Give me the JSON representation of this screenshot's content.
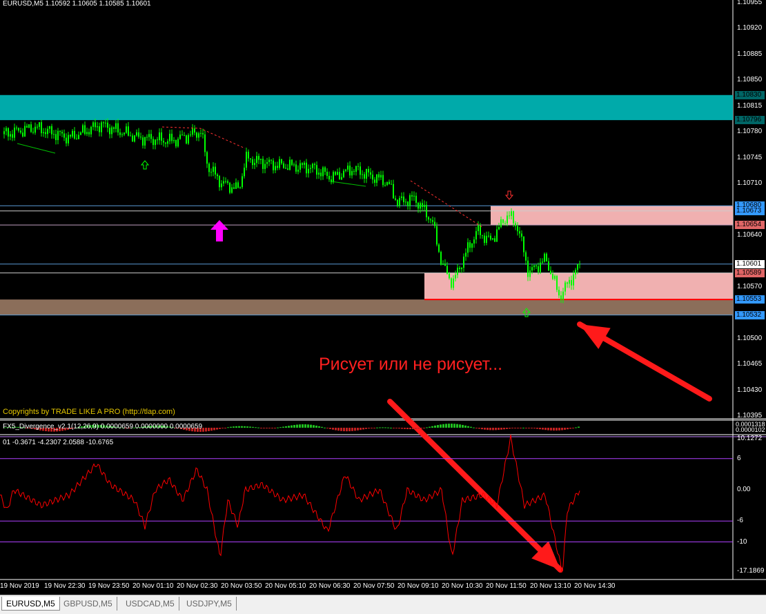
{
  "header": {
    "symbol_info": "EURUSD,M5  1.10592 1.10605 1.10585 1.10601"
  },
  "copyright": "Copyrights by TRADE LIKE A PRO (http://tlap.com)",
  "annotation": "Рисует или не рисует...",
  "macd_panel": {
    "label": "FX5_Divergence_v2.1(12,26,9) 0.0000659 0.0000000 0.0000659",
    "scale_top": "0.0001318",
    "scale_bottom": "0.0000102"
  },
  "osc_panel": {
    "label": "01 -0.3671 -4.2307 2.0588 -10.6765",
    "ticks": [
      "10.1272",
      "6",
      "0.00",
      "-6",
      "-10",
      "-17.1869"
    ]
  },
  "price_axis": {
    "ticks": [
      "1.10955",
      "1.10920",
      "1.10885",
      "1.10850",
      "1.10815",
      "1.10780",
      "1.10745",
      "1.10710",
      "1.10640",
      "1.10570",
      "1.10500",
      "1.10465",
      "1.10430",
      "1.10395"
    ]
  },
  "price_labels": [
    {
      "text": "1.10830",
      "price": 1.1083,
      "bg": "#006666",
      "fg": "#000"
    },
    {
      "text": "1.10796",
      "price": 1.10796,
      "bg": "#006666",
      "fg": "#000"
    },
    {
      "text": "1.10680",
      "price": 1.1068,
      "bg": "#3399ff",
      "fg": "#000"
    },
    {
      "text": "1.10673",
      "price": 1.10673,
      "bg": "#3399ff",
      "fg": "#000"
    },
    {
      "text": "1.10654",
      "price": 1.10654,
      "bg": "#e06666",
      "fg": "#000"
    },
    {
      "text": "1.10601",
      "price": 1.10601,
      "bg": "#ffffff",
      "fg": "#000"
    },
    {
      "text": "1.10589",
      "price": 1.10589,
      "bg": "#e06666",
      "fg": "#000"
    },
    {
      "text": "1.10553",
      "price": 1.10553,
      "bg": "#3399ff",
      "fg": "#000"
    },
    {
      "text": "1.10532",
      "price": 1.10532,
      "bg": "#3399ff",
      "fg": "#000"
    }
  ],
  "time_axis": [
    "19 Nov 2019",
    "19 Nov 22:30",
    "19 Nov 23:50",
    "20 Nov 01:10",
    "20 Nov 02:30",
    "20 Nov 03:50",
    "20 Nov 05:10",
    "20 Nov 06:30",
    "20 Nov 07:50",
    "20 Nov 09:10",
    "20 Nov 10:30",
    "20 Nov 11:50",
    "20 Nov 13:10",
    "20 Nov 14:30"
  ],
  "tabs": [
    "EURUSD,M5",
    "GBPUSD,M5",
    "USDCAD,M5",
    "USDJPY,M5"
  ],
  "colors": {
    "candle": "#00ff00",
    "band": "#00aaaa",
    "zone": "#f0b0b0",
    "brown": "#8b6e5a",
    "arrow": "#ff0000"
  },
  "chart_data": {
    "type": "line",
    "price_range": [
      1.10395,
      1.10955
    ],
    "price_keyframes": [
      [
        5,
        1.10777
      ],
      [
        50,
        1.10786
      ],
      [
        100,
        1.10772
      ],
      [
        145,
        1.1079
      ],
      [
        200,
        1.10772
      ],
      [
        250,
        1.10768
      ],
      [
        290,
        1.10781
      ],
      [
        300,
        1.10734
      ],
      [
        320,
        1.10711
      ],
      [
        345,
        1.10702
      ],
      [
        355,
        1.10744
      ],
      [
        400,
        1.10735
      ],
      [
        450,
        1.10732
      ],
      [
        480,
        1.10718
      ],
      [
        510,
        1.1073
      ],
      [
        560,
        1.10712
      ],
      [
        575,
        1.10685
      ],
      [
        600,
        1.1069
      ],
      [
        625,
        1.1066
      ],
      [
        640,
        1.10599
      ],
      [
        655,
        1.10575
      ],
      [
        670,
        1.10608
      ],
      [
        690,
        1.10646
      ],
      [
        710,
        1.10632
      ],
      [
        735,
        1.10669
      ],
      [
        750,
        1.1065
      ],
      [
        765,
        1.10589
      ],
      [
        790,
        1.10608
      ],
      [
        810,
        1.10557
      ],
      [
        840,
        1.10601
      ]
    ],
    "osc_keyframes": [
      [
        0,
        -1
      ],
      [
        10,
        -4
      ],
      [
        20,
        0
      ],
      [
        60,
        -3
      ],
      [
        100,
        -1
      ],
      [
        140,
        5
      ],
      [
        160,
        1
      ],
      [
        195,
        -2
      ],
      [
        210,
        -7
      ],
      [
        225,
        0
      ],
      [
        245,
        2
      ],
      [
        265,
        -2
      ],
      [
        285,
        4
      ],
      [
        300,
        0
      ],
      [
        319,
        -13
      ],
      [
        330,
        -2
      ],
      [
        345,
        -7
      ],
      [
        355,
        0
      ],
      [
        380,
        1
      ],
      [
        410,
        -2
      ],
      [
        440,
        -1
      ],
      [
        475,
        -8
      ],
      [
        500,
        3
      ],
      [
        520,
        -2
      ],
      [
        550,
        0
      ],
      [
        575,
        -8
      ],
      [
        590,
        0
      ],
      [
        615,
        -2
      ],
      [
        640,
        0
      ],
      [
        655,
        -13
      ],
      [
        670,
        -2
      ],
      [
        700,
        -1
      ],
      [
        720,
        -3
      ],
      [
        740,
        10
      ],
      [
        760,
        -3
      ],
      [
        790,
        -1
      ],
      [
        815,
        -16
      ],
      [
        822,
        -4
      ],
      [
        840,
        0
      ]
    ],
    "osc_range": [
      -17.1869,
      10.1272
    ],
    "levels": [
      6,
      -6,
      -10
    ]
  }
}
